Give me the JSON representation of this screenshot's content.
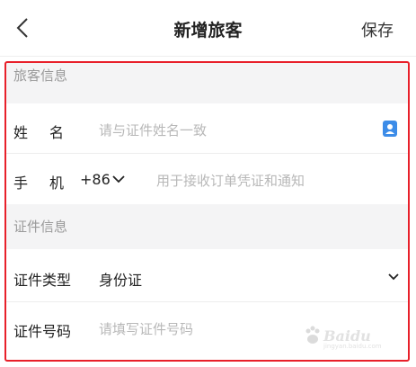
{
  "header": {
    "title": "新增旅客",
    "save_label": "保存",
    "back_icon": "chevron-left-icon"
  },
  "traveler_section": {
    "title": "旅客信息",
    "name_field": {
      "label": "姓　名",
      "placeholder": "请与证件姓名一致",
      "icon": "contact-card-icon"
    },
    "phone_field": {
      "label": "手　机",
      "country_code": "+86",
      "placeholder": "用于接收订单凭证和通知"
    }
  },
  "id_section": {
    "title": "证件信息",
    "type_field": {
      "label": "证件类型",
      "value": "身份证"
    },
    "number_field": {
      "label": "证件号码",
      "placeholder": "请填写证件号码"
    }
  },
  "colors": {
    "highlight_border": "#e8202a",
    "section_bg": "#f4f4f5",
    "icon_blue": "#3c8ce8"
  }
}
